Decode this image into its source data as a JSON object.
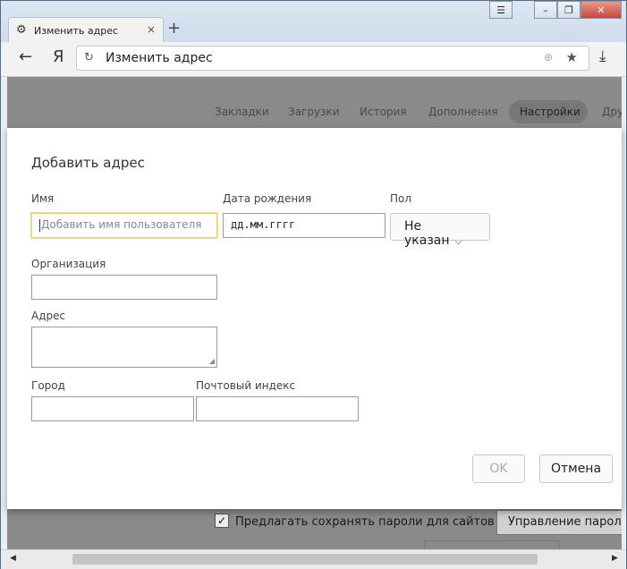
{
  "browser": {
    "tab_title": "Изменить адрес",
    "new_tab_symbol": "+",
    "close_symbol": "×",
    "window_controls": {
      "menu": "☰",
      "minimize": "–",
      "restore": "❐",
      "close": "✕"
    },
    "back_symbol": "←",
    "ya_logo": "Я",
    "reload_symbol": "↻",
    "address_text": "Изменить адрес",
    "globe_symbol": "⊕",
    "star_symbol": "★",
    "download_symbol": "⤓"
  },
  "settings_nav": {
    "items": [
      "Закладки",
      "Загрузки",
      "История",
      "Дополнения",
      "Настройки",
      "Дру"
    ]
  },
  "background_page": {
    "checkbox_mark": "✓",
    "save_passwords_label": "Предлагать сохранять пароли для сайтов",
    "manage_passwords_button": "Управление паролями"
  },
  "dialog": {
    "title": "Добавить адрес",
    "name_label": "Имя",
    "name_placeholder": "Добавить имя пользователя",
    "birth_label": "Дата рождения",
    "birth_value": "дд.мм.гггг",
    "gender_label": "Пол",
    "gender_value": "Не указан",
    "organization_label": "Организация",
    "address_label": "Адрес",
    "city_label": "Город",
    "postcode_label": "Почтовый индекс",
    "ok_button": "OK",
    "cancel_button": "Отмена"
  },
  "scrollbar": {
    "left_arrow": "◀",
    "right_arrow": "▶"
  }
}
